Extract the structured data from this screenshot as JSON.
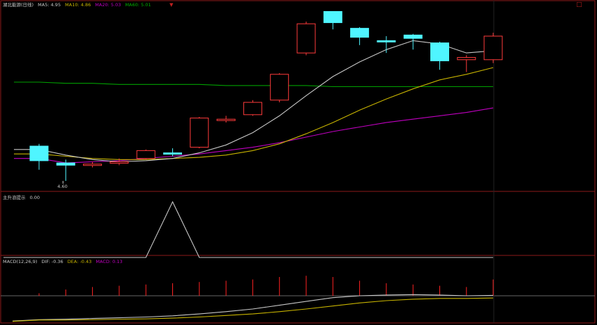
{
  "colors": {
    "background": "#000000",
    "frame": "#8b1a1a",
    "candle_up": "#ff3b3b",
    "candle_down": "#4ff5ff",
    "ma5": "#c8c8c8",
    "ma10": "#c8b400",
    "ma20": "#c000c0",
    "ma60": "#00a000",
    "macd_bar": "#ff2222",
    "dif": "#c8c8c8",
    "dea": "#c8b400",
    "indicator_line": "#c8c8c8"
  },
  "main_panel": {
    "title": "湖北能源(日线)",
    "ma5_label": "MA5: 4.95",
    "ma10_label": "MA10: 4.86",
    "ma20_label": "MA20: 5.03",
    "ma60_label": "MA60: 5.01",
    "low_marker": "4.60"
  },
  "indicator_panel": {
    "title": "主升浪提示",
    "value": "0.00"
  },
  "macd_panel": {
    "title": "MACD(12,26,9)",
    "dif_label": "DIF: -0.36",
    "dea_label": "DEA: -0.43",
    "macd_label": "MACD: 0.13"
  },
  "icons": [
    "close-icon",
    "scroll-arrow-icon"
  ],
  "chart_data": [
    {
      "type": "candlestick",
      "title": "湖北能源(日线)",
      "candles": [
        {
          "o": 4.91,
          "h": 4.93,
          "l": 4.7,
          "c": 4.78
        },
        {
          "o": 4.76,
          "h": 4.79,
          "l": 4.6,
          "c": 4.74
        },
        {
          "o": 4.74,
          "h": 4.77,
          "l": 4.72,
          "c": 4.75
        },
        {
          "o": 4.76,
          "h": 4.8,
          "l": 4.74,
          "c": 4.77
        },
        {
          "o": 4.8,
          "h": 4.88,
          "l": 4.79,
          "c": 4.87
        },
        {
          "o": 4.85,
          "h": 4.89,
          "l": 4.82,
          "c": 4.84
        },
        {
          "o": 4.9,
          "h": 5.17,
          "l": 4.89,
          "c": 5.16
        },
        {
          "o": 5.14,
          "h": 5.18,
          "l": 5.12,
          "c": 5.15
        },
        {
          "o": 5.19,
          "h": 5.32,
          "l": 5.18,
          "c": 5.3
        },
        {
          "o": 5.32,
          "h": 5.56,
          "l": 5.3,
          "c": 5.55
        },
        {
          "o": 5.74,
          "h": 6.02,
          "l": 5.72,
          "c": 6.0
        },
        {
          "o": 6.11,
          "h": 6.11,
          "l": 5.95,
          "c": 6.01
        },
        {
          "o": 5.96,
          "h": 5.97,
          "l": 5.81,
          "c": 5.88
        },
        {
          "o": 5.85,
          "h": 5.89,
          "l": 5.74,
          "c": 5.84
        },
        {
          "o": 5.9,
          "h": 5.91,
          "l": 5.77,
          "c": 5.87
        },
        {
          "o": 5.83,
          "h": 5.84,
          "l": 5.59,
          "c": 5.67
        },
        {
          "o": 5.68,
          "h": 5.72,
          "l": 5.57,
          "c": 5.7
        },
        {
          "o": 5.68,
          "h": 5.92,
          "l": 5.65,
          "c": 5.89
        }
      ],
      "ma5": [
        4.88,
        4.83,
        4.79,
        4.77,
        4.78,
        4.8,
        4.85,
        4.92,
        5.03,
        5.18,
        5.36,
        5.53,
        5.66,
        5.77,
        5.85,
        5.82,
        5.74,
        5.76
      ],
      "ma10": [
        4.84,
        4.82,
        4.8,
        4.79,
        4.79,
        4.8,
        4.81,
        4.83,
        4.87,
        4.93,
        5.02,
        5.12,
        5.23,
        5.33,
        5.42,
        5.5,
        5.55,
        5.61
      ],
      "ma20": [
        4.8,
        4.76,
        4.77,
        4.78,
        4.8,
        4.82,
        4.84,
        4.87,
        4.9,
        4.94,
        4.99,
        5.04,
        5.08,
        5.12,
        5.15,
        5.18,
        5.21,
        5.25
      ],
      "ma60": [
        5.48,
        5.47,
        5.47,
        5.46,
        5.46,
        5.46,
        5.46,
        5.45,
        5.45,
        5.45,
        5.45,
        5.44,
        5.44,
        5.44,
        5.44,
        5.44,
        5.44,
        5.44
      ],
      "ylim": [
        4.55,
        6.15
      ]
    },
    {
      "type": "line",
      "title": "主升浪提示",
      "values": [
        0,
        0,
        0,
        0,
        0,
        1,
        0,
        0,
        0,
        0,
        0,
        0,
        0,
        0,
        0,
        0,
        0,
        0
      ],
      "ylim": [
        0,
        1
      ]
    },
    {
      "type": "bar",
      "title": "MACD(12,26,9)",
      "macd": [
        0.02,
        0.05,
        0.07,
        0.08,
        0.09,
        0.1,
        0.11,
        0.12,
        0.13,
        0.15,
        0.16,
        0.15,
        0.12,
        0.1,
        0.09,
        0.08,
        0.07,
        0.13
      ],
      "dif": [
        -1.0,
        -0.99,
        -0.97,
        -0.95,
        -0.93,
        -0.9,
        -0.85,
        -0.79,
        -0.72,
        -0.62,
        -0.52,
        -0.42,
        -0.37,
        -0.35,
        -0.34,
        -0.35,
        -0.37,
        -0.36
      ],
      "dea": [
        -1.01,
        -1.01,
        -1.0,
        -0.99,
        -0.98,
        -0.96,
        -0.93,
        -0.89,
        -0.85,
        -0.79,
        -0.72,
        -0.64,
        -0.56,
        -0.5,
        -0.46,
        -0.44,
        -0.44,
        -0.43
      ],
      "ylim": [
        -1.05,
        0.18
      ]
    }
  ]
}
